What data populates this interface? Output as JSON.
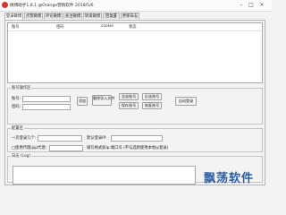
{
  "window": {
    "title": "微博助手1.8.1 @Orange营销软件 2018/5/6",
    "minimize": "–",
    "maximize": "□",
    "close": "×"
  },
  "tabs": [
    "登录微博",
    "点赞微博",
    "评论微博",
    "关注微博",
    "转发微博",
    "回复置",
    "更新日志"
  ],
  "account_table": {
    "columns": [
      "账号",
      "密码",
      "cookie",
      "状态"
    ],
    "rows": []
  },
  "account_ops": {
    "label": "账号操作区",
    "account_label": "账号:",
    "account_value": "",
    "password_label": "密码:",
    "password_value": "",
    "add_button": "添加",
    "import_button": "删除导入文件",
    "select_all_button": "全选账号",
    "invert_select_button": "反选账号",
    "save_account_button": "保存账号",
    "clear_account_button": "恢复账号",
    "auto_login_button": "自动登录"
  },
  "settings": {
    "label": "配置区",
    "login_per_label": "一次登录几个:",
    "login_per_value": "",
    "default_login_label": "默认登录IP:",
    "default_login_value": "",
    "proxy_checkbox_label": "□使用代理ip",
    "proxy_ip_label": "ip代理:",
    "proxy_ip_value": "",
    "proxy_note": "填写格式如ip:端口号 (不勾选则使用本地ip登录)"
  },
  "log": {
    "label": "日志 (Log)",
    "content": ""
  },
  "watermark": "飘荡软件"
}
